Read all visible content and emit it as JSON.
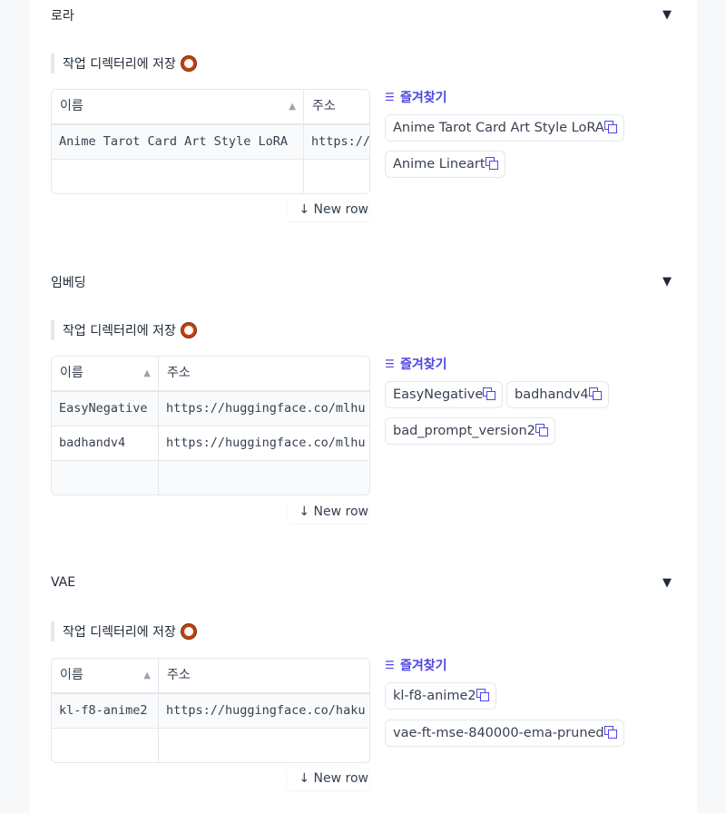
{
  "sections": [
    {
      "title": "로라",
      "save_label": "작업 디렉터리에 저장",
      "columns": [
        "이름",
        "주소"
      ],
      "rows": [
        [
          "Anime Tarot Card Art Style LoRA",
          "https://"
        ],
        [
          "",
          ""
        ]
      ],
      "new_row_label": "↓ New row",
      "favorites_title": "즐겨찾기",
      "favorites": [
        "Anime Tarot Card Art Style LoRA",
        "Anime Lineart"
      ]
    },
    {
      "title": "임베딩",
      "save_label": "작업 디렉터리에 저장",
      "columns": [
        "이름",
        "주소"
      ],
      "rows": [
        [
          "EasyNegative",
          "https://huggingface.co/mlhu"
        ],
        [
          "badhandv4",
          "https://huggingface.co/mlhu"
        ],
        [
          "",
          ""
        ]
      ],
      "new_row_label": "↓ New row",
      "favorites_title": "즐겨찾기",
      "favorites": [
        "EasyNegative",
        "badhandv4",
        "bad_prompt_version2"
      ]
    },
    {
      "title": "VAE",
      "save_label": "작업 디렉터리에 저장",
      "columns": [
        "이름",
        "주소"
      ],
      "rows": [
        [
          "kl-f8-anime2",
          "https://huggingface.co/haku"
        ],
        [
          "",
          ""
        ]
      ],
      "new_row_label": "↓ New row",
      "favorites_title": "즐겨찾기",
      "favorites": [
        "kl-f8-anime2",
        "vae-ft-mse-840000-ema-pruned"
      ]
    }
  ],
  "icons": {
    "collapse": "triangle-down-icon",
    "save_toggle": "radio-ring-icon",
    "sort": "sort-up-icon",
    "favorites": "list-icon",
    "copy": "copy-icon"
  },
  "colors": {
    "accent": "#4f46e5",
    "toggle": "#c2410c",
    "border": "#e5e7eb"
  }
}
